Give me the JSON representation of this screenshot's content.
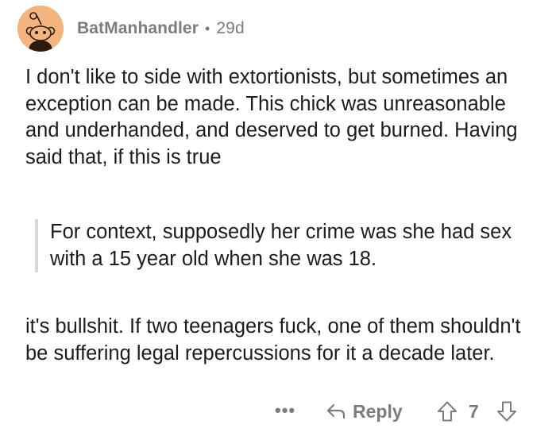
{
  "comment": {
    "author": "BatManhandler",
    "separator": "•",
    "age": "29d",
    "paragraph_1": "I don't like to side with extortionists, but sometimes an exception can be made. This chick was unreasonable and underhanded, and deserved to get burned. Having said that, if this is true",
    "quote": "For context, supposedly her crime was she had sex with a 15 year old when she was 18.",
    "paragraph_2": "it's bullshit. If two teenagers fuck, one of them shouldn't be suffering legal repercussions for it a decade later."
  },
  "actions": {
    "more_label": "•••",
    "reply_label": "Reply",
    "score": "7"
  },
  "icons": {
    "avatar": "snoo-avatar-icon",
    "reply": "reply-arrow-icon",
    "upvote": "upvote-arrow-icon",
    "downvote": "downvote-arrow-icon",
    "more": "more-options-icon"
  },
  "colors": {
    "avatar_background": "#f4b480",
    "meta_text": "#7c7c7c",
    "body_text": "#1c1c1c",
    "quote_bar": "#d7d7d7"
  }
}
